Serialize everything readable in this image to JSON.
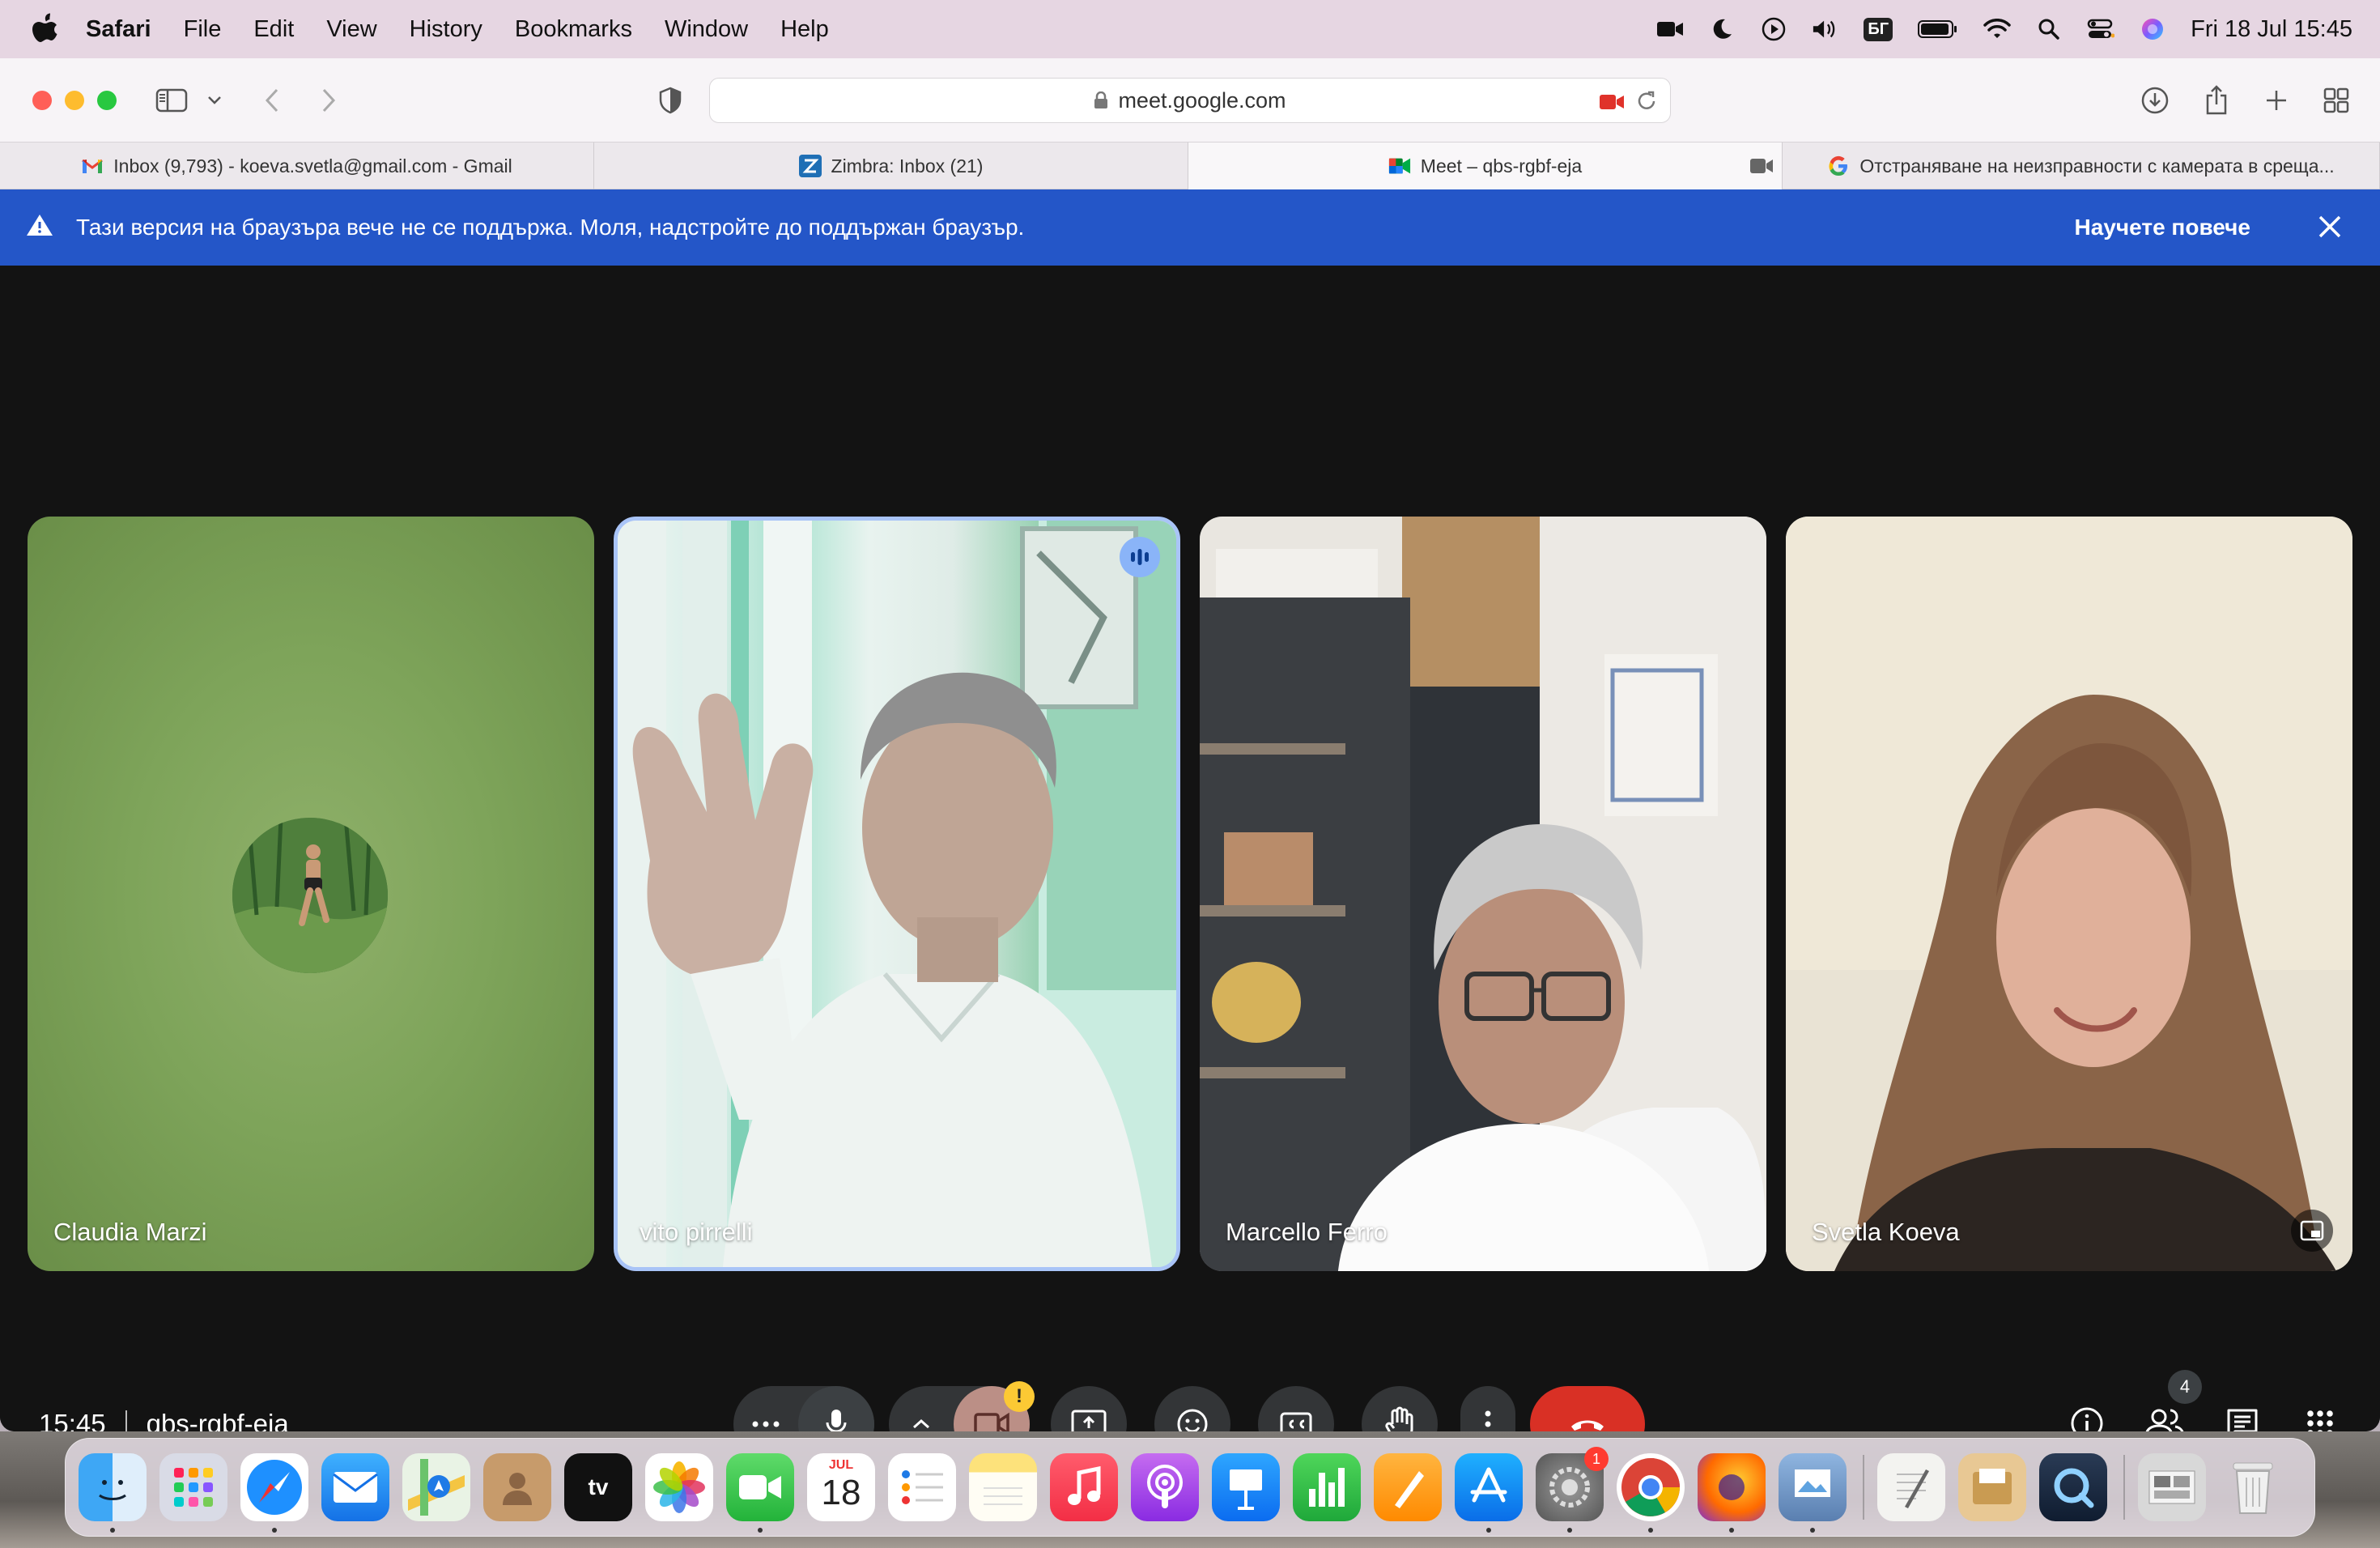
{
  "menubar": {
    "app_name": "Safari",
    "menus": [
      "File",
      "Edit",
      "View",
      "History",
      "Bookmarks",
      "Window",
      "Help"
    ],
    "input_source": "БГ",
    "datetime": "Fri 18 Jul  15:45"
  },
  "browser": {
    "url": "meet.google.com",
    "tabs": [
      {
        "label": "Inbox (9,793) - koeva.svetla@gmail.com - Gmail",
        "icon": "gmail-icon"
      },
      {
        "label": "Zimbra: Inbox (21)",
        "icon": "zimbra-icon"
      },
      {
        "label": "Meet – qbs-rgbf-eja",
        "icon": "meet-icon"
      },
      {
        "label": "Отстраняване на неизправности с камерата в среща...",
        "icon": "google-icon"
      }
    ]
  },
  "banner": {
    "message": "Тази версия на браузъра вече не се поддържа. Моля, надстройте до поддържан браузър.",
    "link": "Научете повече"
  },
  "meet": {
    "participants": [
      {
        "name": "Claudia Marzi"
      },
      {
        "name": "vito pirrelli"
      },
      {
        "name": "Marcello Ferro"
      },
      {
        "name": "Svetla Koeva"
      }
    ],
    "time": "15:45",
    "meeting_code": "qbs-rgbf-eja",
    "camera_warning": "!",
    "people_count": "4"
  },
  "dock": {
    "calendar_month": "JUL",
    "calendar_day": "18",
    "settings_badge": "1"
  },
  "colors": {
    "banner_blue": "#2456c8",
    "end_call_red": "#d93025",
    "speaking_border": "#a9c4f7"
  }
}
